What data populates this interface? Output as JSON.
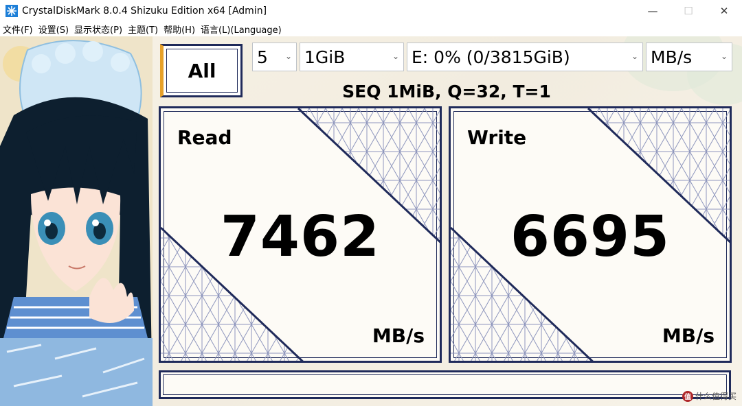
{
  "window": {
    "title": "CrystalDiskMark 8.0.4 Shizuku Edition x64 [Admin]",
    "minimize_icon": "minimize-icon",
    "maximize_icon": "maximize-icon",
    "close_icon": "close-icon",
    "minimize_glyph": "—",
    "maximize_glyph": "☐",
    "close_glyph": "✕"
  },
  "menu": {
    "items": [
      "文件(F)",
      "设置(S)",
      "显示状态(P)",
      "主题(T)",
      "帮助(H)",
      "语言(L)(Language)"
    ]
  },
  "controls": {
    "all_button": "All",
    "count": "5",
    "size": "1GiB",
    "drive": "E: 0% (0/3815GiB)",
    "unit": "MB/s",
    "dropdown_icon": "chevron-down-icon",
    "dropdown_glyph": "⌄"
  },
  "test": {
    "label": "SEQ 1MiB, Q=32, T=1"
  },
  "results": {
    "read": {
      "label": "Read",
      "value": "7462",
      "unit": "MB/s"
    },
    "write": {
      "label": "Write",
      "value": "6695",
      "unit": "MB/s"
    }
  },
  "status": {
    "text": ""
  },
  "watermark": {
    "text": "什么值得买",
    "icon_letter": "值"
  },
  "colors": {
    "frame": "#1f2a5a",
    "accent": "#e7a12a",
    "pattern": "#8e96bd",
    "background": "#f4efe3"
  }
}
